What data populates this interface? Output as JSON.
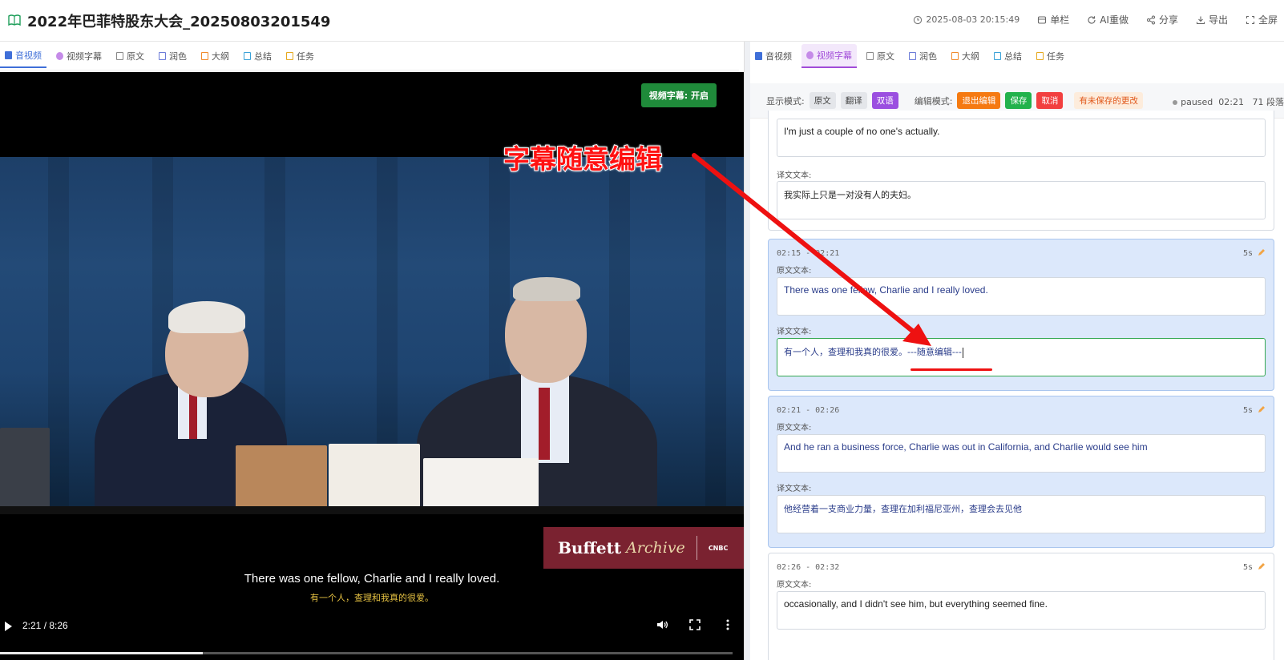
{
  "header": {
    "title": "2022年巴菲特股东大会_20250803201549",
    "timestamp": "2025-08-03 20:15:49",
    "actions": [
      "单栏",
      "AI重做",
      "分享",
      "导出",
      "全屏"
    ]
  },
  "left_tabs": [
    "音视频",
    "视频字幕",
    "原文",
    "润色",
    "大纲",
    "总结",
    "任务"
  ],
  "right_tabs": [
    "音视频",
    "视频字幕",
    "原文",
    "润色",
    "大纲",
    "总结",
    "任务"
  ],
  "video": {
    "cc_badge": "视频字幕: 开启",
    "brand_name": "Buffett",
    "brand_sub": "Archive",
    "brand_network": "CNBC",
    "subtitle_en": "There was one fellow, Charlie and I really loved.",
    "subtitle_zh": "有一个人，查理和我真的很爱。",
    "time": "2:21 / 8:26",
    "progress": 0.277
  },
  "annotation": {
    "text": "字幕随意编辑",
    "color": "#ff1111"
  },
  "toolbar": {
    "display_label": "显示模式:",
    "display_modes": [
      "原文",
      "翻译",
      "双语"
    ],
    "edit_label": "编辑模式:",
    "exit_edit": "退出编辑",
    "save": "保存",
    "cancel": "取消",
    "unsaved": "有未保存的更改",
    "status": "paused",
    "status_time": "02:21",
    "count": "71 段落"
  },
  "segments": [
    {
      "original": "I'm just a couple of no one's actually.",
      "translation_label": "译文文本:",
      "translation": "我实际上只是一对没有人的夫妇。"
    },
    {
      "time": "02:15 - 02:21",
      "dur": "5s",
      "original_label": "原文文本:",
      "original": "There was one fellow, Charlie and I really loved.",
      "translation_label": "译文文本:",
      "translation": "有一个人，查理和我真的很爱。---随意编辑---"
    },
    {
      "time": "02:21 - 02:26",
      "dur": "5s",
      "original_label": "原文文本:",
      "original": "And he ran a business force, Charlie was out in California, and Charlie would see him",
      "translation_label": "译文文本:",
      "translation": "他经营着一支商业力量，查理在加利福尼亚州，查理会去见他"
    },
    {
      "time": "02:26 - 02:32",
      "dur": "5s",
      "original_label": "原文文本:",
      "original": "occasionally, and I didn't see him, but everything seemed fine."
    }
  ],
  "colors": {
    "accent_blue": "#3f6fd8",
    "accent_purple": "#a14bd8",
    "highlight": "#dce8fb",
    "save_green": "#22b24c",
    "exit_orange": "#f57a11",
    "cancel_red": "#f23f3f"
  },
  "icons": [
    "book-icon",
    "clock-icon",
    "columns-icon",
    "refresh-icon",
    "share-icon",
    "download-icon",
    "fullscreen-icon",
    "pencil-icon",
    "play-icon",
    "volume-icon",
    "more-icon"
  ]
}
